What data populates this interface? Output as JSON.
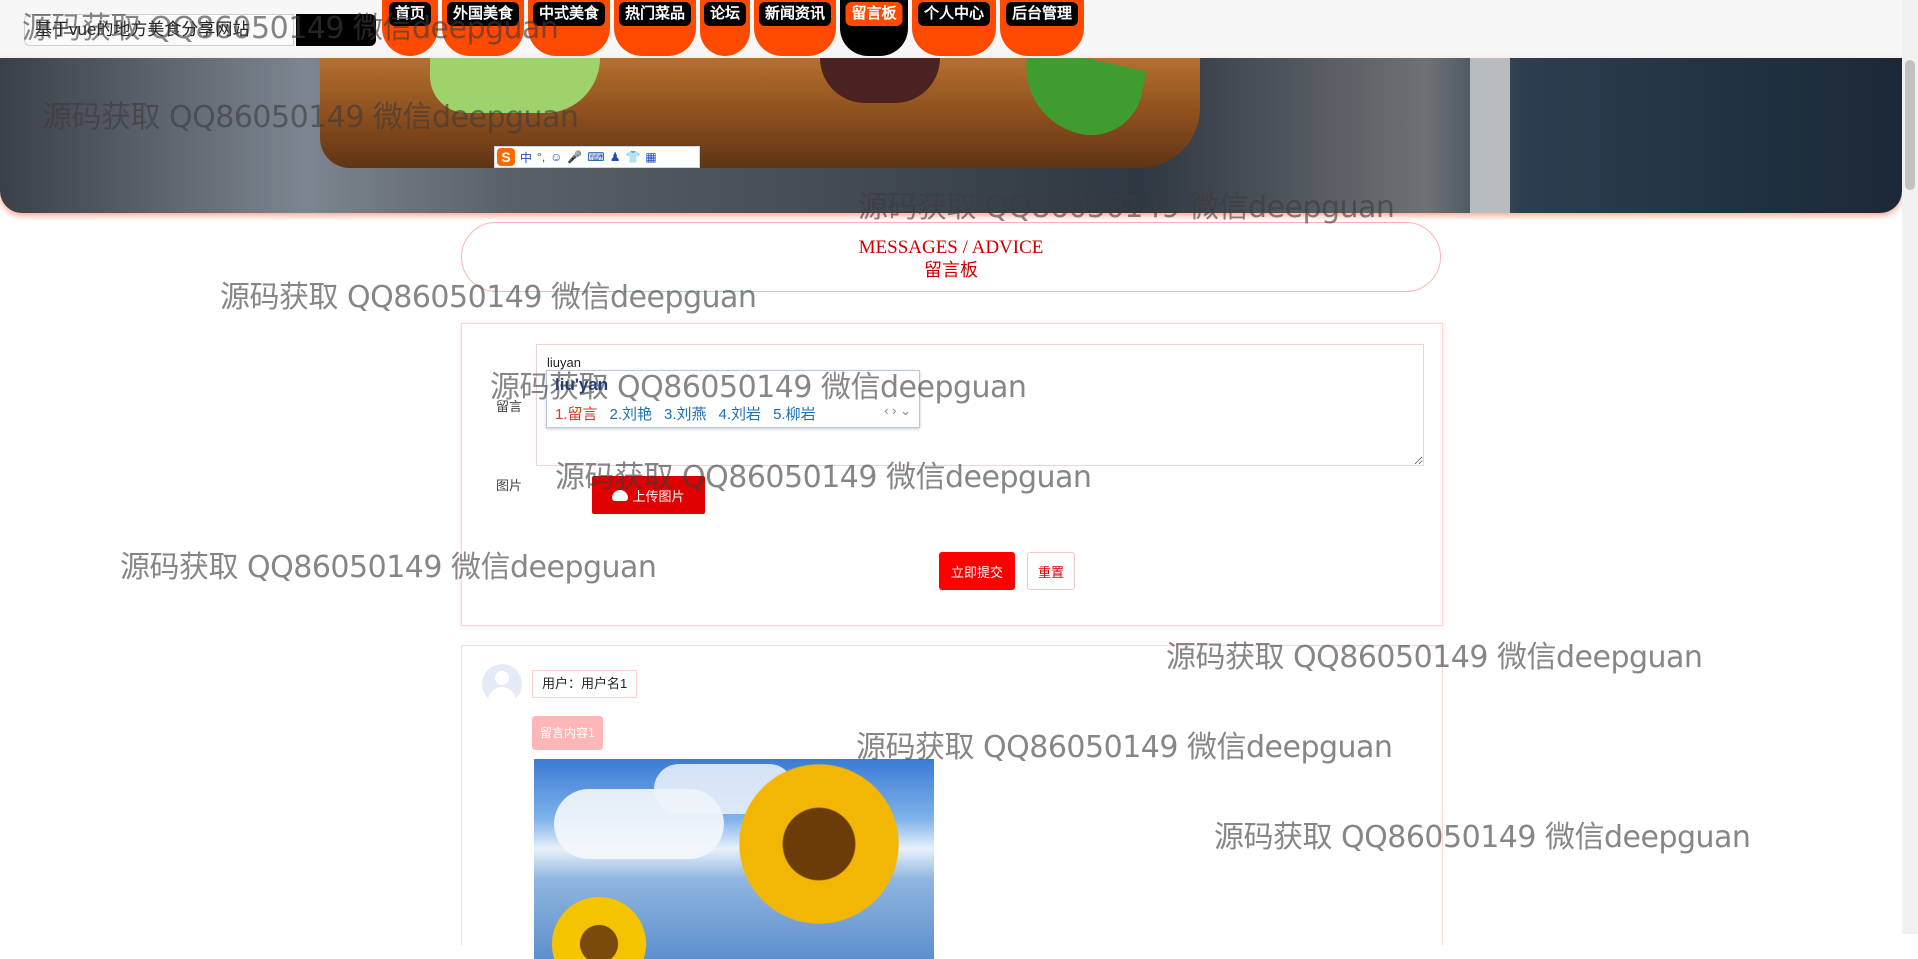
{
  "site": {
    "title": "基于vue的地方美食分享网站"
  },
  "nav": {
    "items": [
      {
        "label": "首页",
        "width": 56
      },
      {
        "label": "外国美食",
        "width": 82
      },
      {
        "label": "中式美食",
        "width": 82
      },
      {
        "label": "热门菜品",
        "width": 82
      },
      {
        "label": "论坛",
        "width": 50
      },
      {
        "label": "新闻资讯",
        "width": 82
      },
      {
        "label": "留言板",
        "width": 68
      },
      {
        "label": "个人中心",
        "width": 84
      },
      {
        "label": "后台管理",
        "width": 84
      }
    ],
    "active_label": "留言板"
  },
  "ime_toolbar": {
    "logo": "S",
    "items": [
      "中",
      "°,",
      "☺",
      "🎤",
      "⌨",
      "♟",
      "👕",
      "▦"
    ]
  },
  "heading": {
    "en": "MESSAGES / ADVICE",
    "zh": "留言板"
  },
  "form": {
    "message_label": "留言",
    "message_value": "liuyan",
    "image_label": "图片",
    "upload_button": "上传图片",
    "submit_button": "立即提交",
    "reset_button": "重置"
  },
  "ime_candidates": {
    "pinyin": "liu'yan",
    "options": [
      "1.留言",
      "2.刘艳",
      "3.刘燕",
      "4.刘岩",
      "5.柳岩"
    ],
    "arrows": "‹ › ⌄"
  },
  "messages": [
    {
      "user": "用户：用户名1",
      "content": "留言内容1"
    }
  ],
  "watermark": "源码获取 QQ86050149 微信deepguan",
  "colors": {
    "accent": "#ff4a00",
    "primary_red": "#ff0000",
    "heading_red": "#cc0000",
    "border_pink": "#ffd5d5"
  }
}
